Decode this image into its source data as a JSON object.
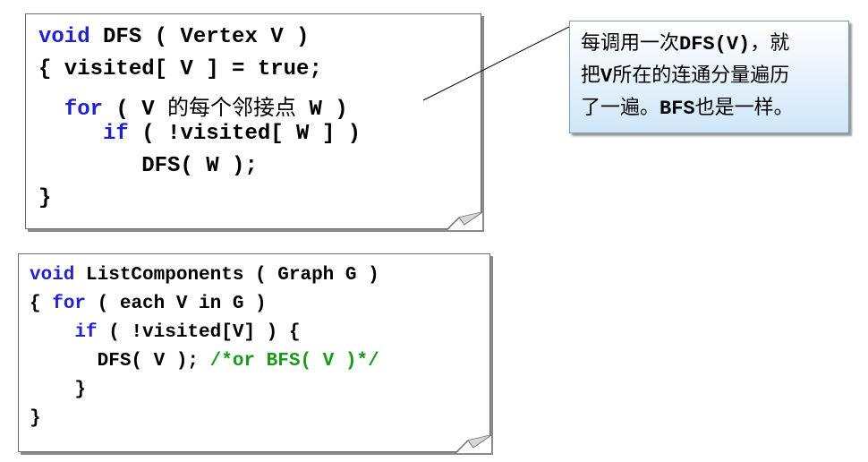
{
  "dfs_note": {
    "lines": [
      [
        {
          "t": "void",
          "c": "kw"
        },
        {
          "t": " DFS ( Vertex V )"
        }
      ],
      [
        {
          "t": "{ visited[ V ] = true;"
        }
      ],
      [
        {
          "t": "  "
        },
        {
          "t": "for",
          "c": "kw"
        },
        {
          "t": " ( V "
        },
        {
          "t": "的每个邻接点",
          "c": "cjk"
        },
        {
          "t": " W )"
        }
      ],
      [
        {
          "t": "     "
        },
        {
          "t": "if",
          "c": "kw"
        },
        {
          "t": " ( !visited[ W ] )"
        }
      ],
      [
        {
          "t": "        DFS( W );"
        }
      ],
      [
        {
          "t": "}"
        }
      ]
    ]
  },
  "list_note": {
    "lines": [
      [
        {
          "t": "void",
          "c": "kw"
        },
        {
          "t": " ListComponents ( Graph G )"
        }
      ],
      [
        {
          "t": "{ "
        },
        {
          "t": "for",
          "c": "kw"
        },
        {
          "t": " ( each V in G )"
        }
      ],
      [
        {
          "t": "    "
        },
        {
          "t": "if",
          "c": "kw"
        },
        {
          "t": " ( !visited[V] ) {"
        }
      ],
      [
        {
          "t": "      DFS( V ); "
        },
        {
          "t": "/*or BFS( V )*/",
          "c": "cm"
        }
      ],
      [
        {
          "t": "    }"
        }
      ],
      [
        {
          "t": "}"
        }
      ]
    ]
  },
  "callout": {
    "lines": [
      [
        {
          "t": "每调用一次"
        },
        {
          "t": "DFS(V)",
          "b": true
        },
        {
          "t": "，就"
        }
      ],
      [
        {
          "t": "把"
        },
        {
          "t": "V",
          "b": true
        },
        {
          "t": "所在的连通分量遍历"
        }
      ],
      [
        {
          "t": "了一遍。"
        },
        {
          "t": "BFS",
          "b": true
        },
        {
          "t": "也是一样。"
        }
      ]
    ]
  },
  "colors": {
    "keyword": "#2222cc",
    "comment": "#1a9a1a",
    "callout_fill": "#cfe6f8"
  }
}
